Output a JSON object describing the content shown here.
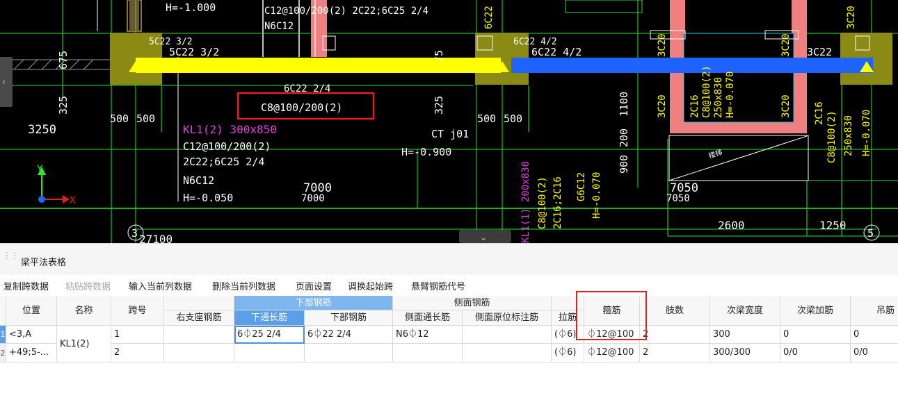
{
  "cad": {
    "labels": {
      "h_top": "H=-1.000",
      "c12_spec_top": "C12@100/200(2) 2C22;6C25 2/4",
      "n6c12_top": "N6C12",
      "dim_675": "675",
      "dim_75": "75",
      "dim_325_left": "325",
      "dim_325_mid": "325",
      "dim_3250": "3250",
      "dim_500a": "500",
      "dim_500b": "500",
      "dim_500c": "500",
      "dim_500d": "500",
      "support_left_small": "5C22 3/2",
      "support_left": "5C22 3/2",
      "support_right_small": "6C22 4/2",
      "support_right": "6C22 4/2",
      "overlap_text": "6C22 2/4",
      "stirrup_highlight": "C8@100/200(2)",
      "kl1_title": "KL1(2) 300x850",
      "kl1_stirrup": "C12@100/200(2)",
      "kl1_bars": "2C22;6C25 2/4",
      "kl1_side": "N6C12",
      "kl1_h": "H=-0.050",
      "ctj01": "CT j01",
      "ctj01_h": "H=-0.900",
      "span_7000a": "7000",
      "span_7000b": "7000",
      "span_7050a": "7050",
      "span_7050b": "7050",
      "dim_2600": "2600",
      "dim_1250": "1250",
      "dim_27100": "27100",
      "axis_3": "3",
      "axis_5": "5",
      "dim_1100": "1100",
      "dim_200": "200",
      "dim_900": "900",
      "col_3c20a": "3C20",
      "col_3c20b": "3C20",
      "col_3c20c": "3C20",
      "col_3c20d": "3C20",
      "col_3c20e": "3C20",
      "col_3c22": "3C22",
      "col_3c20f": "3C20",
      "col_6c22": "6C22",
      "right_2c16": "2C16",
      "right_c8": "C8@100(2)",
      "right_size": "250x830",
      "right_h": "H=-0.070",
      "center_2c16": "2C16",
      "center_c8": "C8@100(2)",
      "center_size": "250x830",
      "center_h": "H=-0.070",
      "stair_label": "楼梯",
      "vert_kl": "KL1(1) 200x830",
      "vert_c8": "C8@100(2)",
      "vert_2c16": "2C16;2C16",
      "vert_g6": "G6C12",
      "vert_h": "H=-0.070",
      "axis_y": "Y",
      "axis_x": "X"
    }
  },
  "panel": {
    "title": "梁平法表格",
    "toolbar": [
      {
        "label": "复制跨数据",
        "enabled": true
      },
      {
        "label": "粘贴跨数据",
        "enabled": false
      },
      {
        "label": "输入当前列数据",
        "enabled": true
      },
      {
        "label": "删除当前列数据",
        "enabled": true
      },
      {
        "label": "页面设置",
        "enabled": true
      },
      {
        "label": "调换起始跨",
        "enabled": true
      },
      {
        "label": "悬臂钢筋代号",
        "enabled": true
      }
    ]
  },
  "table": {
    "group_headers": {
      "bottom_rebar": "下部钢筋",
      "side_rebar": "侧面钢筋"
    },
    "headers": {
      "position": "位置",
      "name": "名称",
      "span": "跨号",
      "right_support": "右支座钢筋",
      "bottom_through": "下通长筋",
      "bottom_rebar": "下部钢筋",
      "side_through": "侧面通长筋",
      "side_in_situ": "侧面原位标注筋",
      "tie": "拉筋",
      "stirrup": "箍筋",
      "legs": "肢数",
      "secondary_width": "次梁宽度",
      "secondary_add": "次梁加筋",
      "hanger": "吊筋"
    },
    "rows": [
      {
        "row_num": "1",
        "position": "<3,A",
        "name": "KL1(2)",
        "span": "1",
        "right_support": "",
        "bottom_through": "6⏀25 2/4",
        "bottom_rebar": "6⏀22 2/4",
        "side_through": "N6⏀12",
        "side_in_situ": "",
        "tie": "(⏀6)",
        "stirrup": "⏀12@100",
        "legs": "2",
        "secondary_width": "300",
        "secondary_add": "0",
        "hanger": "0"
      },
      {
        "row_num": "2",
        "position": "+49;5-...",
        "name": "",
        "span": "2",
        "right_support": "",
        "bottom_through": "",
        "bottom_rebar": "",
        "side_through": "",
        "side_in_situ": "",
        "tie": "(⏀6)",
        "stirrup": "⏀12@100",
        "legs": "2",
        "secondary_width": "300/300",
        "secondary_add": "0/0",
        "hanger": "0/0"
      }
    ]
  },
  "colors": {
    "cad_bg": "#000000",
    "cad_green": "#27e82a",
    "cad_white": "#ffffff",
    "beam_yellow": "#ffff00",
    "beam_blue": "#1e63ff",
    "column_olive": "#8a8a14",
    "wall_pink": "#f08080",
    "magenta": "#e040e0",
    "highlight_red": "#e3201b",
    "header_blue": "#5a9fe8"
  }
}
